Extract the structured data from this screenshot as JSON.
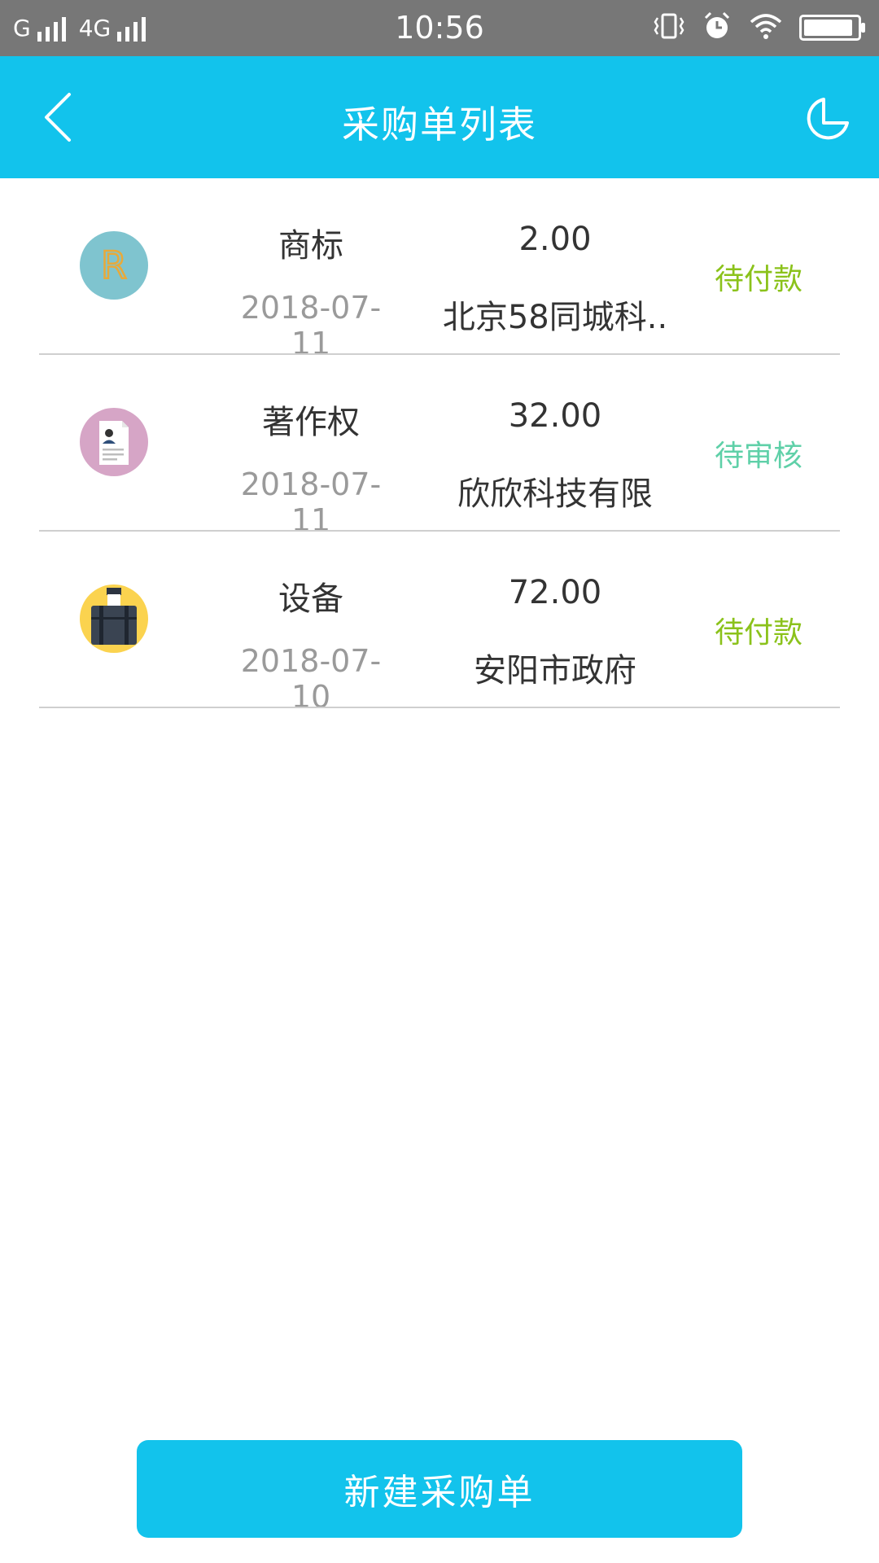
{
  "status_bar": {
    "carrier1": "G",
    "carrier2": "4G",
    "time": "10:56",
    "battery_level": 0.92
  },
  "header": {
    "title": "采购单列表",
    "back_icon": "chevron-left-icon",
    "history_icon": "pie-chart-icon",
    "background": "#12c3ec"
  },
  "orders": [
    {
      "category": "商标",
      "date": "2018-07-11",
      "amount": "2.00",
      "company": "北京58同城科..",
      "status": "待付款",
      "status_color": "#8bc21b",
      "icon": "trademark-r-icon",
      "icon_bg": "#7fc4cf"
    },
    {
      "category": "著作权",
      "date": "2018-07-11",
      "amount": "32.00",
      "company": "欣欣科技有限",
      "status": "待审核",
      "status_color": "#5fd0a8",
      "icon": "document-person-icon",
      "icon_bg": "#d6a5c6"
    },
    {
      "category": "设备",
      "date": "2018-07-10",
      "amount": "72.00",
      "company": "安阳市政府",
      "status": "待付款",
      "status_color": "#8bc21b",
      "icon": "briefcase-icon",
      "icon_bg": "#fbd34f"
    }
  ],
  "footer": {
    "new_button_label": "新建采购单"
  }
}
